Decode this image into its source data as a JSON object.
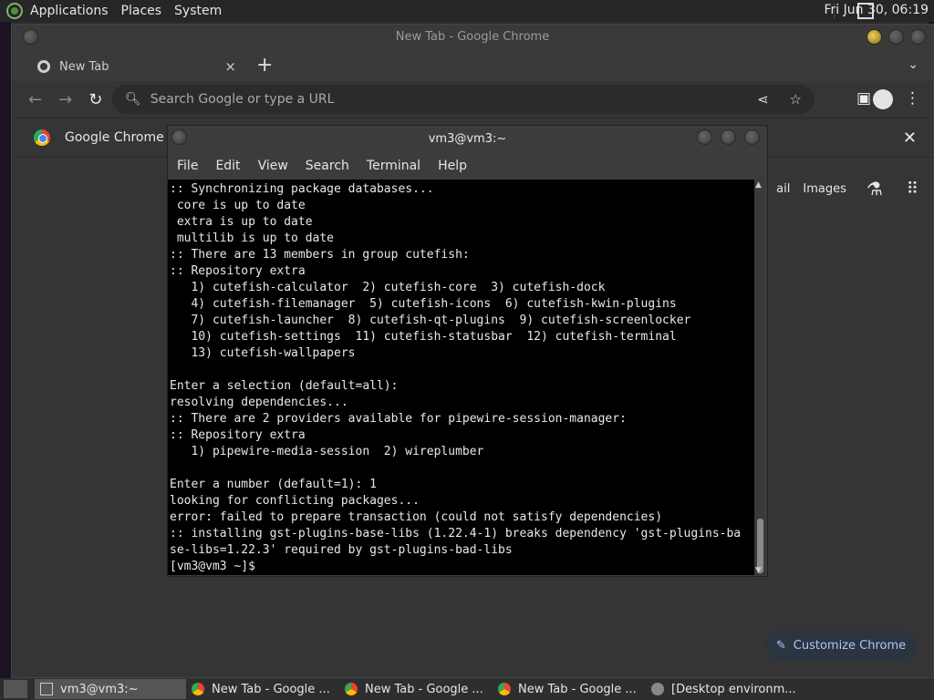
{
  "top_panel": {
    "menus": [
      "Applications",
      "Places",
      "System"
    ],
    "clock": "Fri Jun 30, 06:19"
  },
  "chrome": {
    "window_title": "New Tab - Google Chrome",
    "tab_label": "New Tab",
    "tab_close": "×",
    "new_tab": "+",
    "tab_dropdown": "⌄",
    "omnibox_placeholder": "Search Google or type a URL",
    "infobar_text": "Google Chrome is",
    "infobar_close": "✕",
    "ntp_link_gmail": "ail",
    "ntp_link_images": "Images",
    "customize_label": "Customize Chrome"
  },
  "terminal": {
    "title": "vm3@vm3:~",
    "menu": [
      "File",
      "Edit",
      "View",
      "Search",
      "Terminal",
      "Help"
    ],
    "lines": [
      ":: Synchronizing package databases...",
      " core is up to date",
      " extra is up to date",
      " multilib is up to date",
      ":: There are 13 members in group cutefish:",
      ":: Repository extra",
      "   1) cutefish-calculator  2) cutefish-core  3) cutefish-dock",
      "   4) cutefish-filemanager  5) cutefish-icons  6) cutefish-kwin-plugins",
      "   7) cutefish-launcher  8) cutefish-qt-plugins  9) cutefish-screenlocker",
      "   10) cutefish-settings  11) cutefish-statusbar  12) cutefish-terminal",
      "   13) cutefish-wallpapers",
      "",
      "Enter a selection (default=all):",
      "resolving dependencies...",
      ":: There are 2 providers available for pipewire-session-manager:",
      ":: Repository extra",
      "   1) pipewire-media-session  2) wireplumber",
      "",
      "Enter a number (default=1): 1",
      "looking for conflicting packages...",
      "error: failed to prepare transaction (could not satisfy dependencies)",
      ":: installing gst-plugins-base-libs (1.22.4-1) breaks dependency 'gst-plugins-ba",
      "se-libs=1.22.3' required by gst-plugins-bad-libs",
      "[vm3@vm3 ~]$ "
    ]
  },
  "taskbar": {
    "items": [
      {
        "label": "vm3@vm3:~",
        "active": true,
        "icon": "terminal-icon"
      },
      {
        "label": "New Tab - Google ...",
        "active": false,
        "icon": "chrome-icon"
      },
      {
        "label": "New Tab - Google ...",
        "active": false,
        "icon": "chrome-icon"
      },
      {
        "label": "New Tab - Google ...",
        "active": false,
        "icon": "chrome-icon"
      },
      {
        "label": "[Desktop environm...",
        "active": false,
        "icon": "chrome-icon"
      }
    ]
  },
  "colors": {
    "panel": "#262626",
    "chrome_bg": "#353535",
    "terminal_bg": "#000000",
    "accent_blue": "#aac8f5"
  }
}
